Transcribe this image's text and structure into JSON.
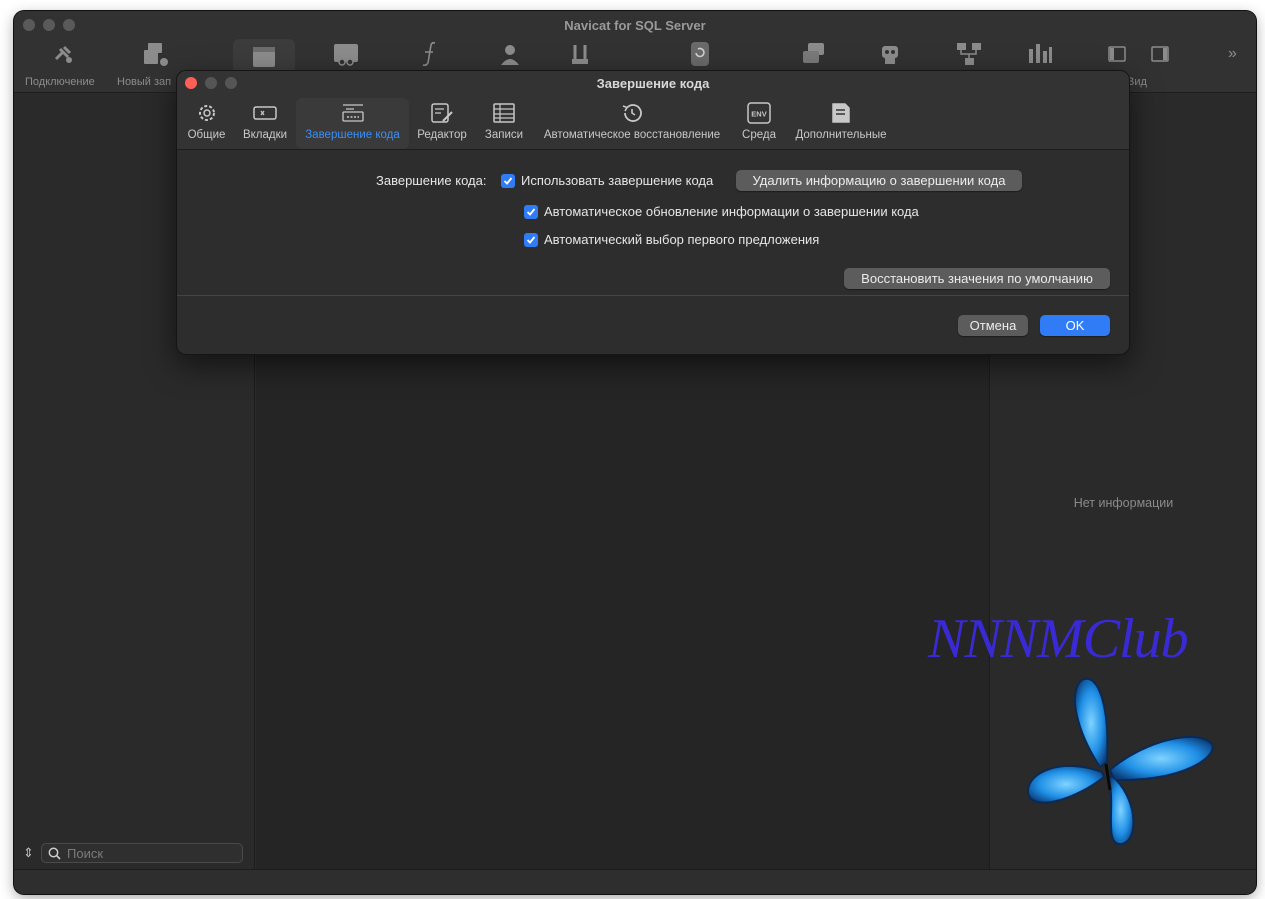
{
  "app": {
    "title": "Navicat for SQL Server"
  },
  "toolbar": {
    "connection_label": "Подключение",
    "new_query_label": "Новый зап",
    "view_label": "Вид",
    "overflow_icon": "chevron-double-right-icon"
  },
  "sidebar": {
    "search_placeholder": "Поиск"
  },
  "right_panel": {
    "empty_text": "Нет информации"
  },
  "dialog": {
    "title": "Завершение кода",
    "tabs": [
      {
        "label": "Общие",
        "icon": "gear-icon",
        "active": false
      },
      {
        "label": "Вкладки",
        "icon": "tabs-icon",
        "active": false
      },
      {
        "label": "Завершение кода",
        "icon": "code-completion-icon",
        "active": true
      },
      {
        "label": "Редактор",
        "icon": "editor-icon",
        "active": false
      },
      {
        "label": "Записи",
        "icon": "records-icon",
        "active": false
      },
      {
        "label": "Автоматическое восстановление",
        "icon": "history-icon",
        "active": false
      },
      {
        "label": "Среда",
        "icon": "env-icon",
        "active": false
      },
      {
        "label": "Дополнительные",
        "icon": "advanced-icon",
        "active": false
      }
    ],
    "env_icon_text": "ENV",
    "completion_label": "Завершение кода:",
    "use_completion_label": "Использовать завершение кода",
    "use_completion_checked": true,
    "delete_info_button": "Удалить информацию о завершении кода",
    "auto_update_label": "Автоматическое обновление информации о завершении кода",
    "auto_update_checked": true,
    "auto_select_label": "Автоматический выбор первого предложения",
    "auto_select_checked": true,
    "restore_defaults_button": "Восстановить значения по умолчанию",
    "cancel_button": "Отмена",
    "ok_button": "OK"
  },
  "watermark": {
    "text": "NNNMClub"
  },
  "colors": {
    "accent": "#2f7cf6",
    "close": "#fe5f57",
    "watermark": "#3a2ad6"
  }
}
